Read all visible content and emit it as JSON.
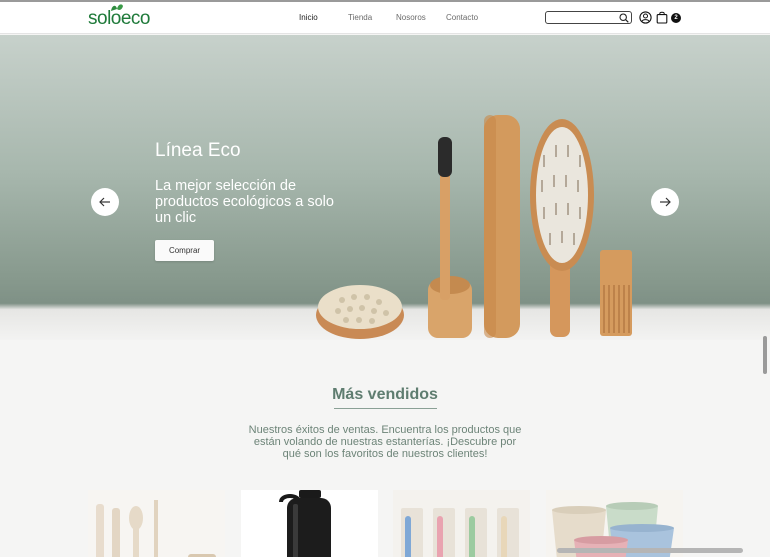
{
  "brand": {
    "logo_text_left": "solo",
    "logo_text_right": "eco"
  },
  "nav": {
    "items": [
      "Inicio",
      "Tienda",
      "Nosoros",
      "Contacto"
    ]
  },
  "header": {
    "search_placeholder": "",
    "cart_count": "2"
  },
  "hero": {
    "title": "Línea Eco",
    "subtitle": "La mejor selección de productos ecológicos a solo un clic",
    "button_label": "Comprar"
  },
  "bestsellers": {
    "title": "Más vendidos",
    "description": "Nuestros éxitos de ventas. Encuentra los productos que están volando de nuestras estanterías. ¡Descubre por qué son los favoritos de nuestros clientes!"
  },
  "colors": {
    "brand_green": "#1f7a3a",
    "section_text": "#5f7d70",
    "hero_bg": "#a7b7ad"
  },
  "icons": [
    "leaf-icon",
    "search-icon",
    "user-icon",
    "cart-icon",
    "arrow-left-icon",
    "arrow-right-icon"
  ]
}
